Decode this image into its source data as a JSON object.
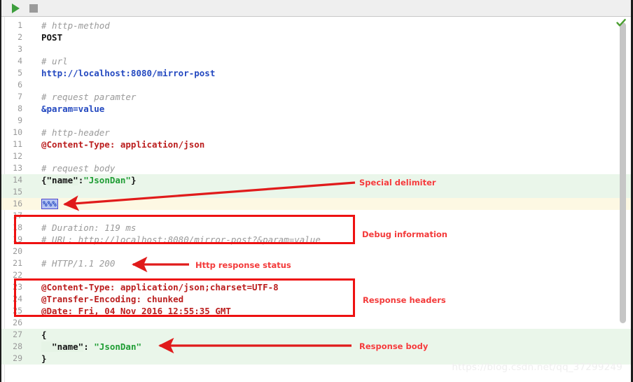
{
  "toolbar": {
    "run_label": "Run",
    "stop_label": "Stop",
    "run_icon": "play-triangle-icon",
    "stop_icon": "stop-square-icon"
  },
  "editor": {
    "inspection_status_icon": "green-check-icon",
    "lines": [
      {
        "no": "1",
        "bg": "none",
        "tokens": [
          {
            "t": "# http-method",
            "c": "t-comment"
          }
        ]
      },
      {
        "no": "2",
        "bg": "none",
        "tokens": [
          {
            "t": "POST",
            "c": "t-plain"
          }
        ]
      },
      {
        "no": "3",
        "bg": "none",
        "tokens": []
      },
      {
        "no": "4",
        "bg": "none",
        "tokens": [
          {
            "t": "# url",
            "c": "t-comment"
          }
        ]
      },
      {
        "no": "5",
        "bg": "none",
        "tokens": [
          {
            "t": "http://localhost:8080/mirror-post",
            "c": "t-url"
          }
        ]
      },
      {
        "no": "6",
        "bg": "none",
        "tokens": []
      },
      {
        "no": "7",
        "bg": "none",
        "tokens": [
          {
            "t": "# request paramter",
            "c": "t-comment"
          }
        ]
      },
      {
        "no": "8",
        "bg": "none",
        "tokens": [
          {
            "t": "&param=value",
            "c": "t-param"
          }
        ]
      },
      {
        "no": "9",
        "bg": "none",
        "tokens": []
      },
      {
        "no": "10",
        "bg": "none",
        "tokens": [
          {
            "t": "# http-header",
            "c": "t-comment"
          }
        ]
      },
      {
        "no": "11",
        "bg": "none",
        "tokens": [
          {
            "t": "@Content-Type: application/json",
            "c": "t-header"
          }
        ]
      },
      {
        "no": "12",
        "bg": "none",
        "tokens": []
      },
      {
        "no": "13",
        "bg": "none",
        "tokens": [
          {
            "t": "# request body",
            "c": "t-comment"
          }
        ]
      },
      {
        "no": "14",
        "bg": "green",
        "tokens": [
          {
            "t": "{",
            "c": "t-brace"
          },
          {
            "t": "\"name\"",
            "c": "t-key"
          },
          {
            "t": ":",
            "c": "t-punct"
          },
          {
            "t": "\"JsonDan\"",
            "c": "t-str"
          },
          {
            "t": "}",
            "c": "t-brace"
          }
        ]
      },
      {
        "no": "15",
        "bg": "green",
        "tokens": []
      },
      {
        "no": "16",
        "bg": "yellow",
        "tokens": [
          {
            "t": "%%%",
            "c": "sel-token"
          }
        ]
      },
      {
        "no": "17",
        "bg": "none",
        "tokens": []
      },
      {
        "no": "18",
        "bg": "none",
        "tokens": [
          {
            "t": "# Duration: 119 ms",
            "c": "t-comment"
          }
        ]
      },
      {
        "no": "19",
        "bg": "none",
        "tokens": [
          {
            "t": "# URL: http://localhost:8080/mirror-post?&param=value",
            "c": "t-comment"
          }
        ]
      },
      {
        "no": "20",
        "bg": "none",
        "tokens": []
      },
      {
        "no": "21",
        "bg": "none",
        "tokens": [
          {
            "t": "# HTTP/1.1 200",
            "c": "t-comment"
          }
        ]
      },
      {
        "no": "22",
        "bg": "none",
        "tokens": []
      },
      {
        "no": "23",
        "bg": "none",
        "tokens": [
          {
            "t": "@Content-Type: application/json;charset=UTF-8",
            "c": "t-header"
          }
        ]
      },
      {
        "no": "24",
        "bg": "none",
        "tokens": [
          {
            "t": "@Transfer-Encoding: chunked",
            "c": "t-header"
          }
        ]
      },
      {
        "no": "25",
        "bg": "none",
        "tokens": [
          {
            "t": "@Date: Fri, 04 Nov 2016 12:55:35 GMT",
            "c": "t-header"
          }
        ]
      },
      {
        "no": "26",
        "bg": "none",
        "tokens": []
      },
      {
        "no": "27",
        "bg": "green",
        "tokens": [
          {
            "t": "{",
            "c": "t-brace"
          }
        ]
      },
      {
        "no": "28",
        "bg": "green",
        "tokens": [
          {
            "t": "  \"name\"",
            "c": "t-key"
          },
          {
            "t": ": ",
            "c": "t-punct"
          },
          {
            "t": "\"JsonDan\"",
            "c": "t-str"
          }
        ]
      },
      {
        "no": "29",
        "bg": "green",
        "tokens": [
          {
            "t": "}",
            "c": "t-brace"
          }
        ]
      }
    ]
  },
  "annotations": [
    {
      "id": "special-delimiter",
      "label": "Special delimiter"
    },
    {
      "id": "debug-information",
      "label": "Debug information"
    },
    {
      "id": "http-response-status",
      "label": "Http response status"
    },
    {
      "id": "response-headers",
      "label": "Response headers"
    },
    {
      "id": "response-body",
      "label": "Response body"
    }
  ],
  "colors": {
    "annotation_red": "#ee1111",
    "label_red": "#f33a3a",
    "highlight_green": "#eaf6ea",
    "highlight_yellow": "#fdf8e3",
    "url_blue": "#2449c0",
    "header_red": "#bb1e1e",
    "string_green": "#1f9d34",
    "comment_gray": "#9a9a9a"
  },
  "watermark": {
    "text": "https://blog.csdn.net/qq_37299249"
  }
}
